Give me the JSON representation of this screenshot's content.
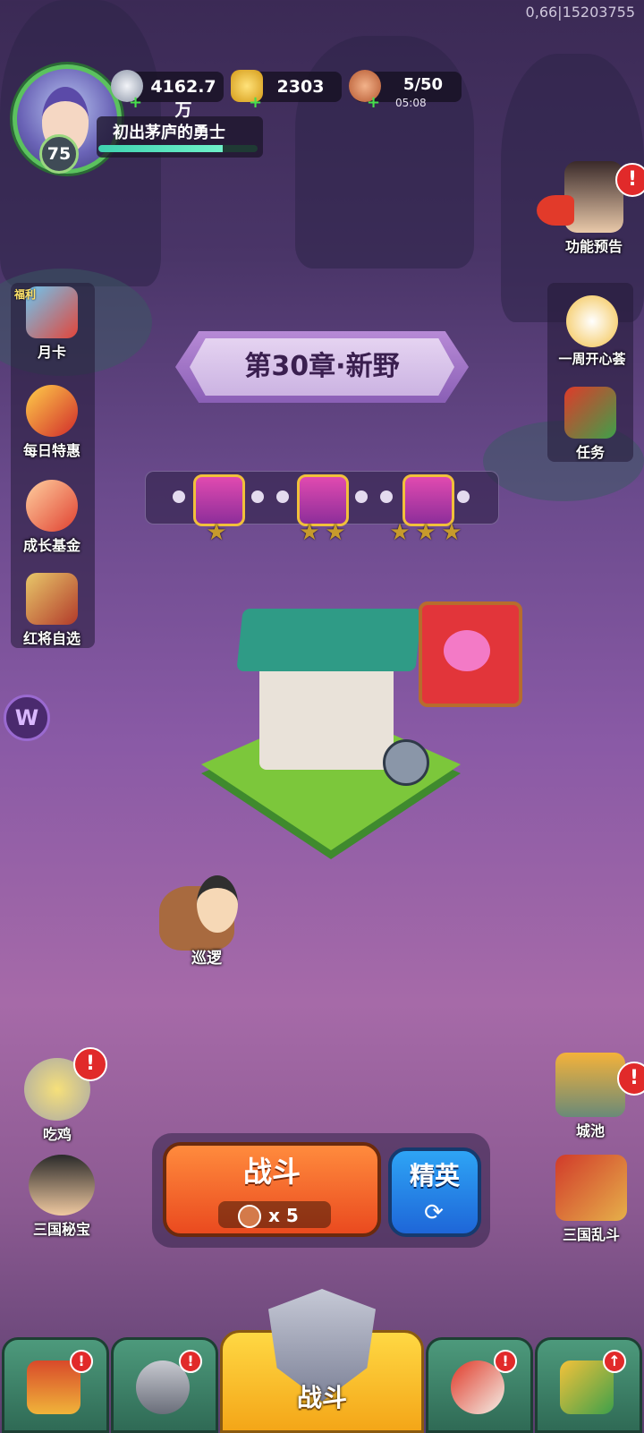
{
  "debug_text": "0,66|15203755",
  "player": {
    "level": "75",
    "title": "初出茅庐的勇士",
    "exp_fraction": 0.78
  },
  "resources": {
    "silver": "4162.7万",
    "gold": "2303",
    "stamina": "5/50",
    "stamina_timer": "05:08"
  },
  "left_menu": [
    {
      "label": "月卡",
      "icon": "monthly-card-icon",
      "tag": "福利"
    },
    {
      "label": "每日特惠",
      "icon": "gift-bag-icon"
    },
    {
      "label": "成长基金",
      "icon": "fund-icon"
    },
    {
      "label": "红将自选",
      "icon": "hero-select-icon"
    }
  ],
  "right_menu": [
    {
      "label": "功能预告",
      "icon": "preview-icon",
      "badge": "!"
    },
    {
      "label": "一周开心荟",
      "icon": "weekly-event-icon"
    },
    {
      "label": "任务",
      "icon": "quest-scroll-icon"
    }
  ],
  "chapter": {
    "title": "第30章·新野",
    "chest_stars": [
      1,
      2,
      3
    ]
  },
  "patrol_label": "巡逻",
  "side_events_left": [
    {
      "label": "吃鸡",
      "badge": "!"
    },
    {
      "label": "三国秘宝"
    }
  ],
  "side_events_right": [
    {
      "label": "城池",
      "badge": "!"
    },
    {
      "label": "三国乱斗"
    }
  ],
  "actions": {
    "fight_label": "战斗",
    "fight_cost": "x 5",
    "elite_label": "精英"
  },
  "bottom_nav": {
    "active_label": "战斗",
    "tabs": [
      "shop-tab",
      "hero-tab",
      "battle-tab",
      "event-tab",
      "upgrade-tab"
    ]
  },
  "colors": {
    "fight_button": "#ea4a1f",
    "elite_button": "#1e66d8",
    "badge": "#e12a2a",
    "active_tab": "#f4a618"
  }
}
